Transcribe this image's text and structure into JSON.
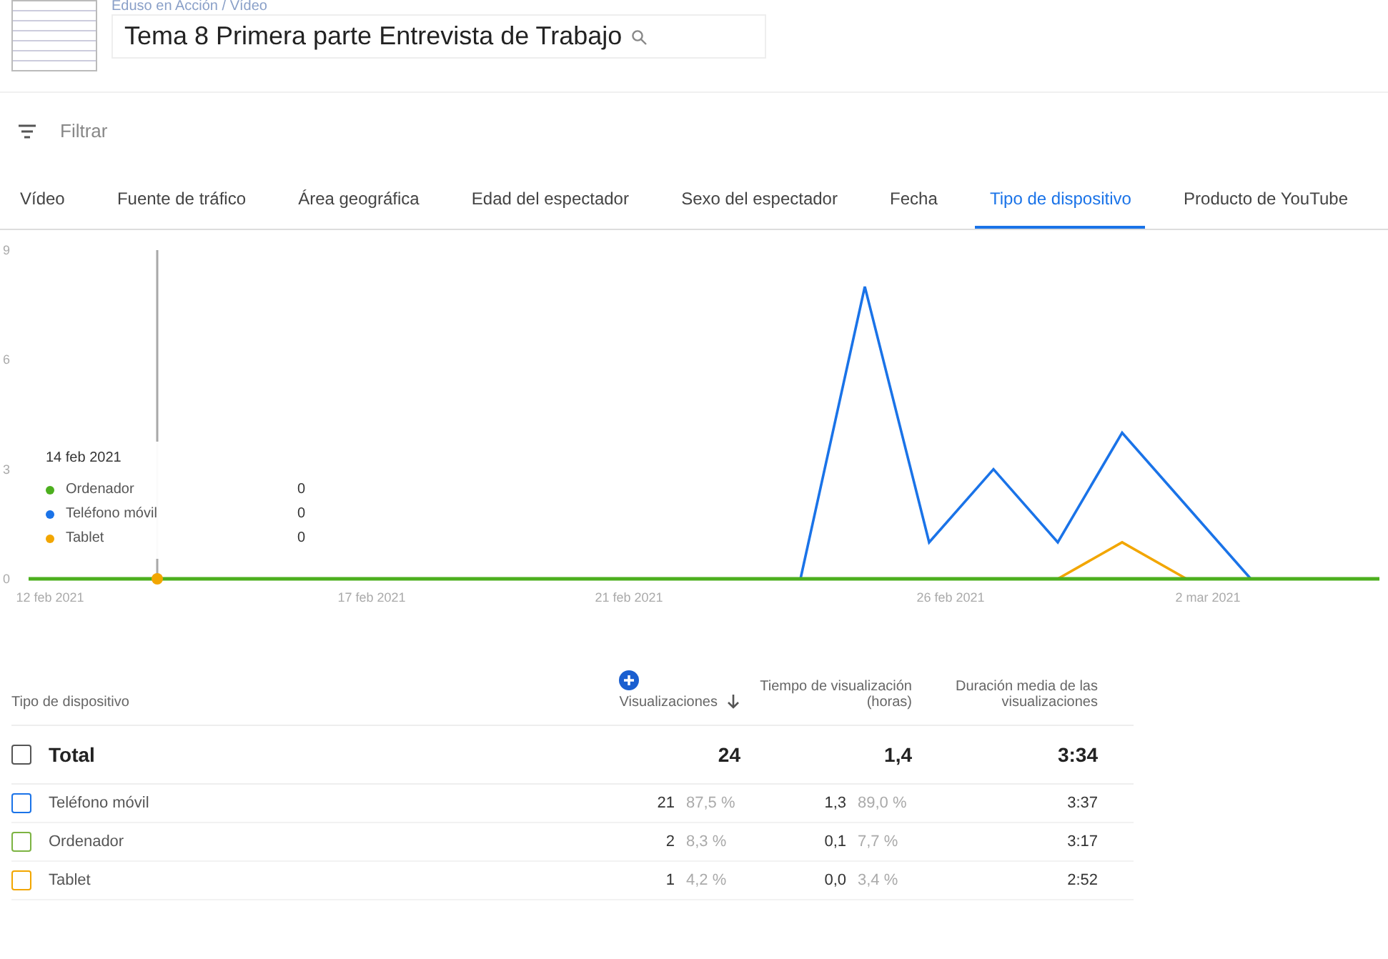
{
  "header": {
    "breadcrumb": "Eduso en Acción / Vídeo",
    "title": "Tema 8 Primera parte Entrevista de Trabajo"
  },
  "filter": {
    "placeholder": "Filtrar"
  },
  "tabs": [
    {
      "label": "Vídeo",
      "selected": false
    },
    {
      "label": "Fuente de tráfico",
      "selected": false
    },
    {
      "label": "Área geográfica",
      "selected": false
    },
    {
      "label": "Edad del espectador",
      "selected": false
    },
    {
      "label": "Sexo del espectador",
      "selected": false
    },
    {
      "label": "Fecha",
      "selected": false
    },
    {
      "label": "Tipo de dispositivo",
      "selected": true
    },
    {
      "label": "Producto de YouTube",
      "selected": false
    }
  ],
  "chart": {
    "chart_data": {
      "type": "line",
      "legend": "lower left",
      "categories": [
        "12 feb 2021",
        null,
        null,
        null,
        null,
        "17 feb 2021",
        null,
        null,
        null,
        "21 feb 2021",
        null,
        null,
        null,
        null,
        "26 feb 2021",
        null,
        null,
        null,
        "2 mar 2021",
        null,
        null,
        null
      ],
      "yticks": [
        0,
        3,
        6,
        9
      ],
      "ylim": [
        0,
        9
      ],
      "series": [
        {
          "name": "Ordenador",
          "color": "#4caf1e",
          "values": [
            0,
            0,
            0,
            0,
            0,
            0,
            0,
            0,
            0,
            0,
            0,
            0,
            0,
            0,
            0,
            0,
            0,
            0,
            0,
            0,
            0,
            0
          ]
        },
        {
          "name": "Teléfono móvil",
          "color": "#1a73e8",
          "values": [
            null,
            null,
            null,
            null,
            null,
            null,
            null,
            null,
            null,
            null,
            null,
            null,
            0,
            8,
            1,
            3,
            1,
            4,
            2,
            0,
            null,
            null
          ]
        },
        {
          "name": "Tablet",
          "color": "#f2a600",
          "values": [
            null,
            null,
            null,
            null,
            null,
            null,
            null,
            null,
            null,
            null,
            null,
            null,
            null,
            null,
            null,
            null,
            0,
            1,
            0,
            null,
            null,
            null
          ]
        }
      ]
    },
    "tooltip": {
      "date": "14 feb 2021",
      "values": [
        "0",
        "0",
        "0"
      ]
    }
  },
  "table": {
    "columns": [
      "Tipo de dispositivo",
      "Visualizaciones",
      "Tiempo de visualización (horas)",
      "Duración media de las visualizaciones"
    ],
    "total": {
      "label": "Total",
      "checked": false,
      "views": "24",
      "watch": "1,4",
      "avg": "3:34"
    },
    "rows": [
      {
        "label": "Teléfono móvil",
        "color": "#1a73e8",
        "checked": false,
        "views": "21",
        "views_pct": "87,5 %",
        "watch": "1,3",
        "watch_pct": "89,0 %",
        "avg": "3:37"
      },
      {
        "label": "Ordenador",
        "color": "#7cb342",
        "checked": false,
        "views": "2",
        "views_pct": "8,3 %",
        "watch": "0,1",
        "watch_pct": "7,7 %",
        "avg": "3:17"
      },
      {
        "label": "Tablet",
        "color": "#f2a600",
        "checked": false,
        "views": "1",
        "views_pct": "4,2 %",
        "watch": "0,0",
        "watch_pct": "3,4 %",
        "avg": "2:52"
      }
    ]
  }
}
